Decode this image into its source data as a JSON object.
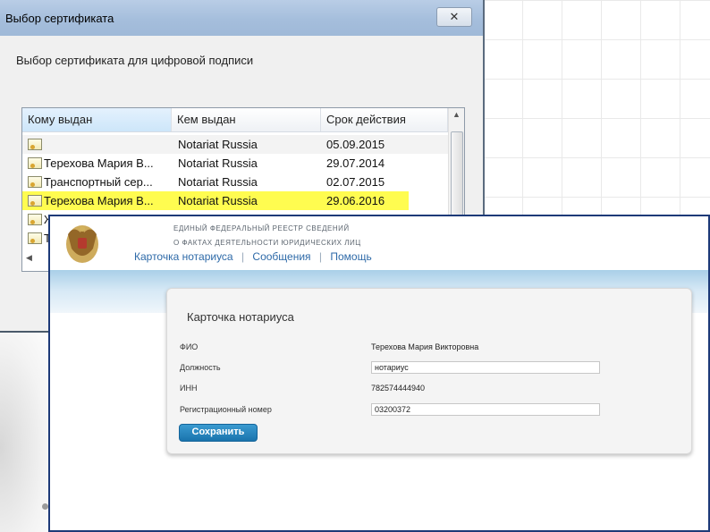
{
  "dialog": {
    "title": "Выбор сертификата",
    "close_glyph": "✕",
    "subtitle": "Выбор сертификата для цифровой подписи",
    "columns": [
      "Кому выдан",
      "Кем выдан",
      "Срок действия"
    ],
    "rows": [
      {
        "issued_to": "",
        "issued_by": "Notariat Russia",
        "expires": "05.09.2015"
      },
      {
        "issued_to": "Терехова Мария В...",
        "issued_by": "Notariat Russia",
        "expires": "29.07.2014"
      },
      {
        "issued_to": "Транспортный сер...",
        "issued_by": "Notariat Russia",
        "expires": "02.07.2015"
      },
      {
        "issued_to": "Терехова Мария В...",
        "issued_by": "Notariat Russia",
        "expires": "29.06.2016"
      },
      {
        "issued_to": "Ж",
        "issued_by": "",
        "expires": ""
      },
      {
        "issued_to": "Т",
        "issued_by": "",
        "expires": ""
      }
    ],
    "highlight_color": "#fffc50"
  },
  "site": {
    "registry_line1": "ЕДИНЫЙ ФЕДЕРАЛЬНЫЙ РЕЕСТР СВЕДЕНИЙ",
    "registry_line2": "О ФАКТАХ ДЕЯТЕЛЬНОСТИ ЮРИДИЧЕСКИХ ЛИЦ",
    "nav": [
      "Карточка нотариуса",
      "Сообщения",
      "Помощь"
    ],
    "nav_separator": "|",
    "accent_color": "#2e6aa8"
  },
  "card": {
    "title": "Карточка нотариуса",
    "fio_label": "ФИО",
    "fio_value": "Терехова Мария Викторовна",
    "position_label": "Должность",
    "position_value": "нотариус",
    "inn_label": "ИНН",
    "inn_value": "782574444940",
    "regnum_label": "Регистрационный номер",
    "regnum_value": "03200372",
    "save_label": "Сохранить",
    "button_color": "#2a86c0"
  }
}
